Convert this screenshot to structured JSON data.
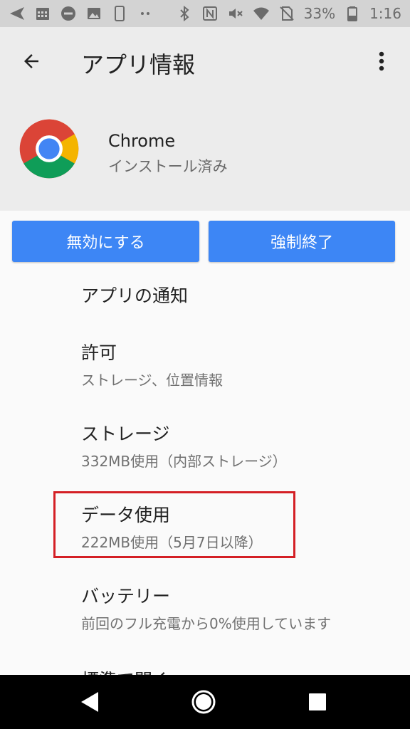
{
  "status_bar": {
    "battery_percent": "33%",
    "time": "1:16"
  },
  "header": {
    "title": "アプリ情報"
  },
  "app": {
    "name": "Chrome",
    "status": "インストール済み"
  },
  "buttons": {
    "disable": "無効にする",
    "force_stop": "強制終了"
  },
  "list": [
    {
      "title": "アプリの通知"
    },
    {
      "title": "許可",
      "subtitle": "ストレージ、位置情報"
    },
    {
      "title": "ストレージ",
      "subtitle": "332MB使用（内部ストレージ）"
    },
    {
      "title": "データ使用",
      "subtitle": "222MB使用（5月7日以降）"
    },
    {
      "title": "バッテリー",
      "subtitle": "前回のフル充電から0%使用しています"
    },
    {
      "title": "標準で開く"
    }
  ],
  "colors": {
    "accent_button": "#3d86f5",
    "highlight": "#d41f25"
  }
}
